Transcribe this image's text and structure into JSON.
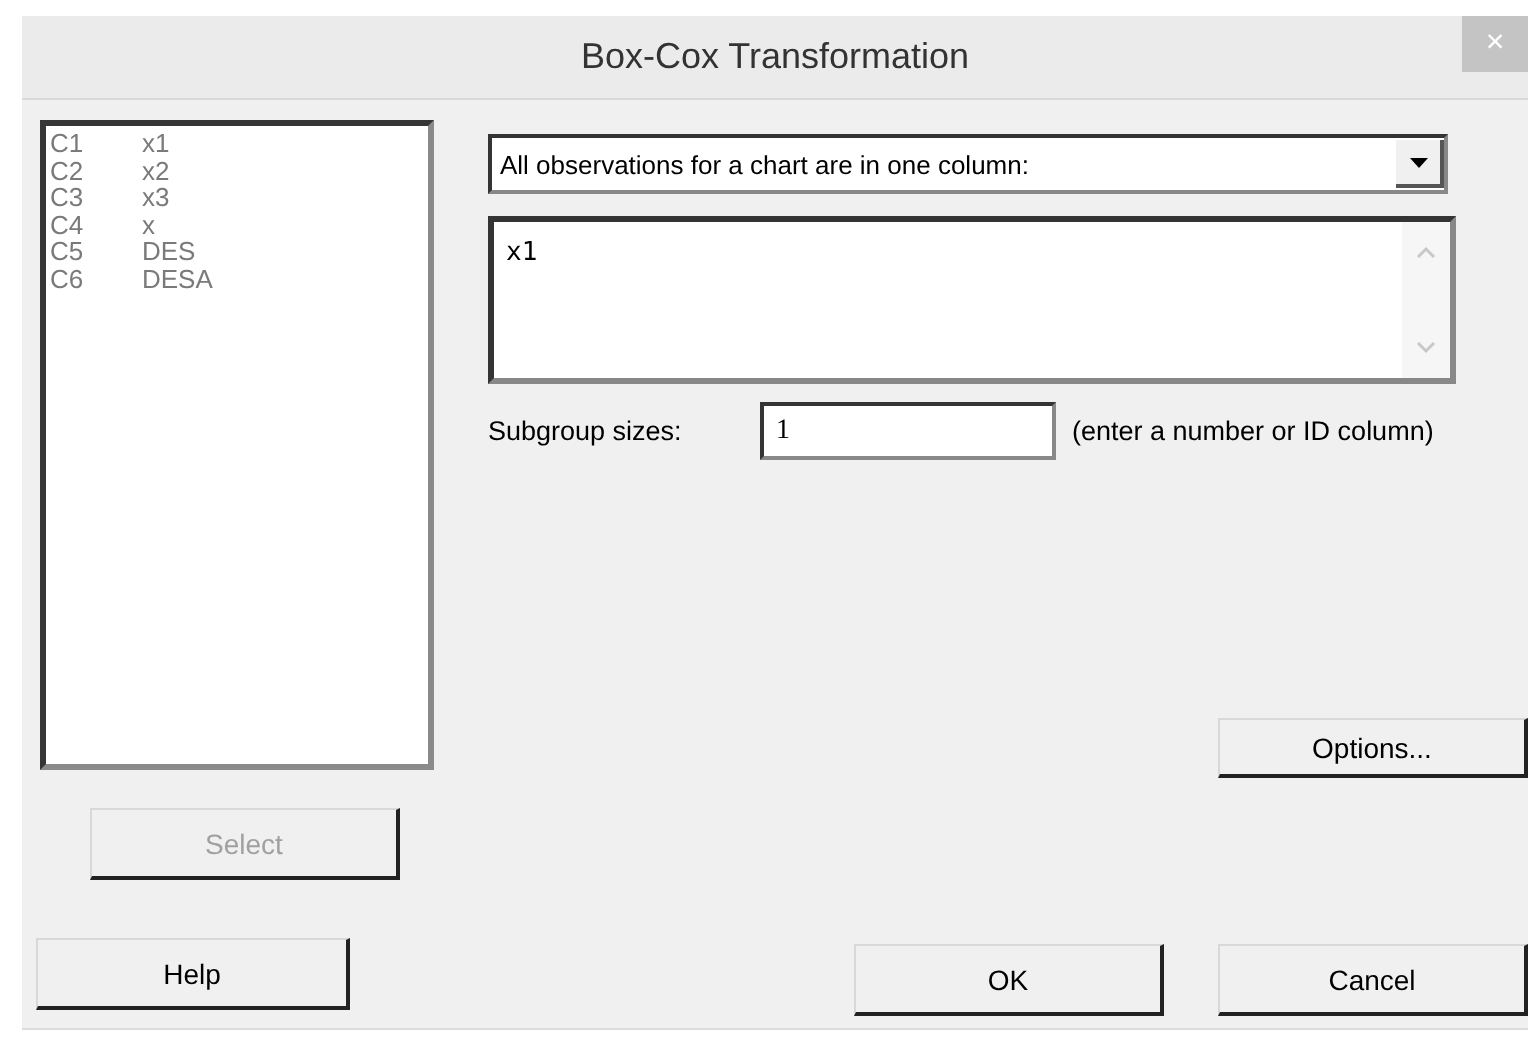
{
  "window": {
    "title": "Box-Cox Transformation",
    "close": "×"
  },
  "columns_list": [
    {
      "id": "C1",
      "name": "x1"
    },
    {
      "id": "C2",
      "name": "x2"
    },
    {
      "id": "C3",
      "name": "x3"
    },
    {
      "id": "C4",
      "name": "x"
    },
    {
      "id": "C5",
      "name": "DES"
    },
    {
      "id": "C6",
      "name": "DESA"
    }
  ],
  "select_button": {
    "label": "Select",
    "disabled": true
  },
  "layout_dropdown": {
    "value": "All observations for a chart are in one column:"
  },
  "variables_box": {
    "value": "x1"
  },
  "subgroup": {
    "label": "Subgroup sizes:",
    "value": "1",
    "hint": "(enter a number or ID column)"
  },
  "buttons": [
    {
      "kind": "options",
      "label": "Options..."
    },
    {
      "kind": "help",
      "label": "Help"
    },
    {
      "kind": "ok",
      "label": "OK"
    },
    {
      "kind": "cancel",
      "label": "Cancel"
    }
  ]
}
